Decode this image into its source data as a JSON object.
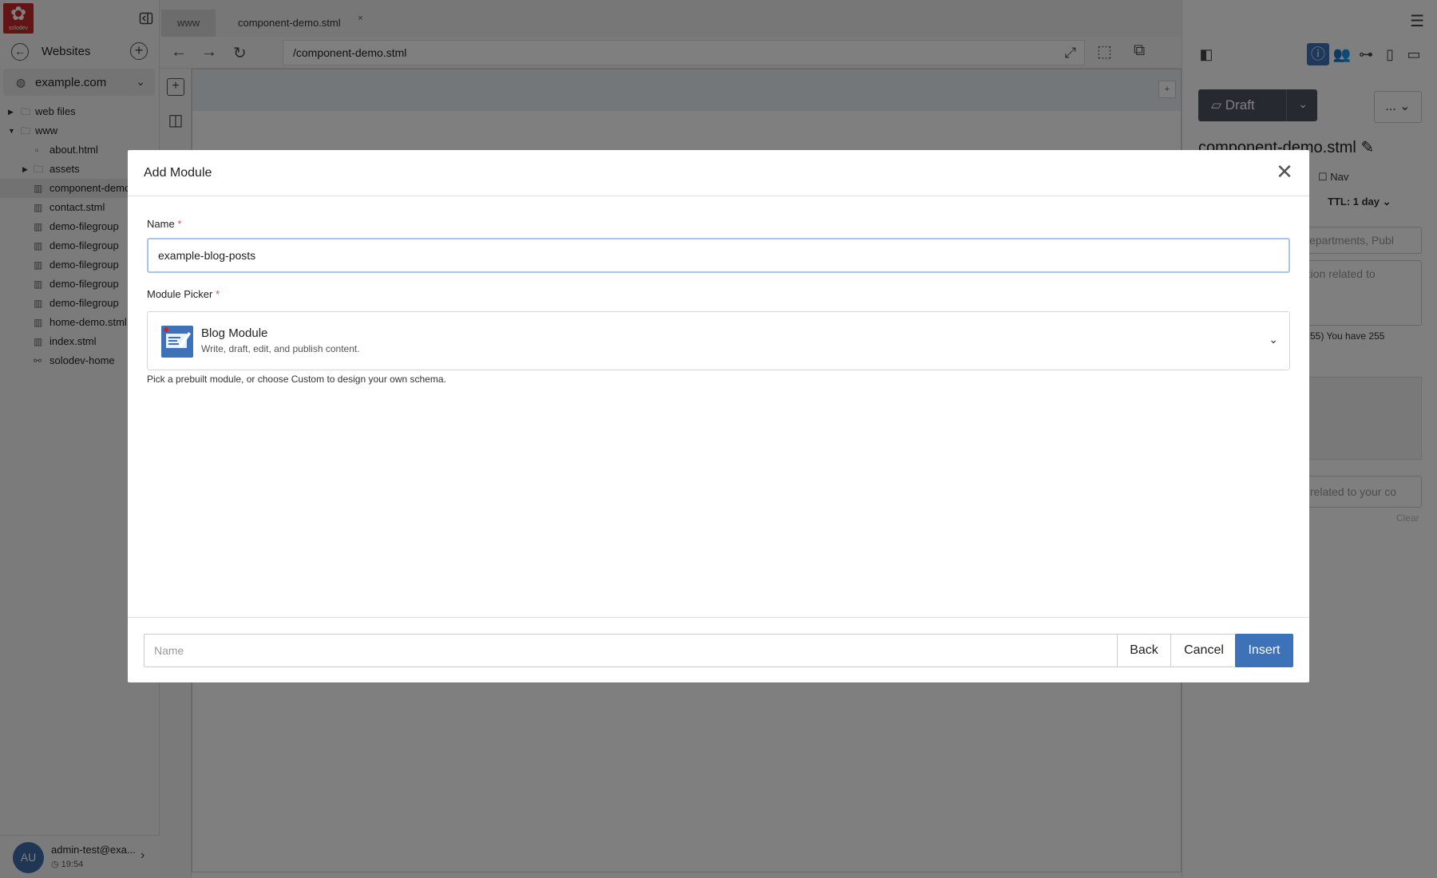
{
  "sidebar": {
    "logo_text": "solodev",
    "websites_title": "Websites",
    "site_select": "example.com",
    "tree": [
      {
        "label": "web files",
        "type": "folder",
        "depth": 0,
        "expanded": false
      },
      {
        "label": "www",
        "type": "folder",
        "depth": 0,
        "expanded": true
      },
      {
        "label": "about.html",
        "type": "file",
        "depth": 1
      },
      {
        "label": "assets",
        "type": "folder",
        "depth": 1,
        "expanded": false
      },
      {
        "label": "component-demo.stml",
        "type": "page",
        "depth": 1
      },
      {
        "label": "contact.stml",
        "type": "page",
        "depth": 1
      },
      {
        "label": "demo-filegroup",
        "type": "page",
        "depth": 1
      },
      {
        "label": "demo-filegroup",
        "type": "page",
        "depth": 1
      },
      {
        "label": "demo-filegroup",
        "type": "page",
        "depth": 1
      },
      {
        "label": "demo-filegroup",
        "type": "page",
        "depth": 1
      },
      {
        "label": "demo-filegroup",
        "type": "page",
        "depth": 1
      },
      {
        "label": "home-demo.stml",
        "type": "page",
        "depth": 1
      },
      {
        "label": "index.stml",
        "type": "page",
        "depth": 1
      },
      {
        "label": "solodev-home",
        "type": "link",
        "depth": 1
      }
    ],
    "user": {
      "initials": "AU",
      "email": "admin-test@exa...",
      "time": "19:54"
    }
  },
  "tabs": [
    {
      "label": "www",
      "active": false
    },
    {
      "label": "component-demo.stml",
      "active": true
    }
  ],
  "url": "/component-demo.stml",
  "right_panel": {
    "status": "Draft",
    "more_label": "...",
    "title": "component-demo.stml",
    "nav_label": "Nav",
    "ttl_label": "TTL: 1 day",
    "tags_placeholder": "Departments, Publ",
    "description_placeholder": "ption related to",
    "char_count": "55) You have 255",
    "keywords_placeholder": "s related to your co",
    "clear_label": "Clear"
  },
  "modal": {
    "title": "Add Module",
    "name_label": "Name",
    "name_value": "example-blog-posts",
    "picker_label": "Module Picker",
    "picker_name": "Blog Module",
    "picker_desc": "Write, draft, edit, and publish content.",
    "help_text": "Pick a prebuilt module, or choose Custom to design your own schema.",
    "footer_placeholder": "Name",
    "back_label": "Back",
    "cancel_label": "Cancel",
    "insert_label": "Insert"
  },
  "colors": {
    "accent": "#3d72b8",
    "brand": "#c62828",
    "overlay": "rgba(0,0,0,0.5)",
    "required": "#d9534f"
  }
}
